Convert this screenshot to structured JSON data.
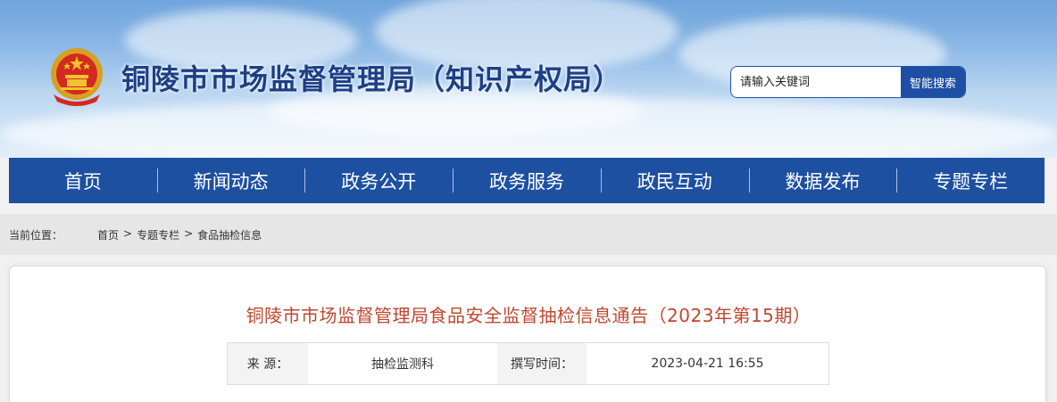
{
  "header": {
    "site_title": "铜陵市市场监督管理局（知识产权局）",
    "search": {
      "placeholder": "请输入关键词",
      "button_label": "智能搜索"
    }
  },
  "nav": {
    "items": [
      {
        "label": "首页"
      },
      {
        "label": "新闻动态"
      },
      {
        "label": "政务公开"
      },
      {
        "label": "政务服务"
      },
      {
        "label": "政民互动"
      },
      {
        "label": "数据发布"
      },
      {
        "label": "专题专栏"
      }
    ]
  },
  "breadcrumb": {
    "label": "当前位置：",
    "items": [
      "首页",
      "专题专栏",
      "食品抽检信息"
    ],
    "separator": ">"
  },
  "article": {
    "title": "铜陵市市场监督管理局食品安全监督抽检信息通告（2023年第15期）",
    "source_label": "来  源：",
    "source_value": "抽检监测科",
    "time_label": "撰写时间：",
    "time_value": "2023-04-21 16:55"
  },
  "colors": {
    "nav_bg": "#1e50a2",
    "title_text": "#1d3f86",
    "article_title": "#c0462e",
    "search_button": "#1f4fa4"
  }
}
